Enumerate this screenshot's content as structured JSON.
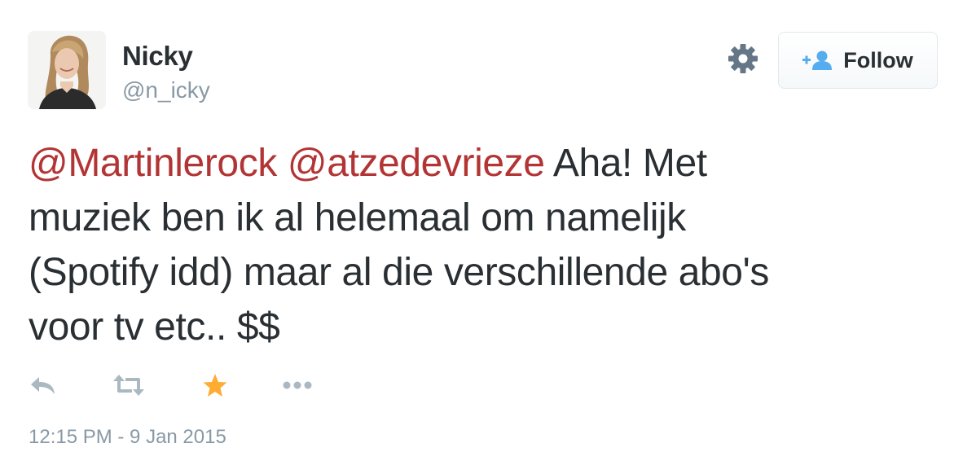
{
  "user": {
    "name": "Nicky",
    "handle": "@n_icky"
  },
  "header": {
    "follow_label": "Follow"
  },
  "tweet": {
    "mentions": [
      "@Martinlerock",
      "@atzedevrieze"
    ],
    "text_lines": [
      " Aha! Met",
      "muziek ben ik al helemaal om namelijk",
      "(Spotify idd) maar al die verschillende abo's",
      "voor tv etc.. $$"
    ],
    "timestamp": "12:15 PM - 9 Jan 2015",
    "favorited": true
  },
  "actions": [
    "reply-icon",
    "retweet-icon",
    "star-icon",
    "more-icon"
  ],
  "colors": {
    "mention": "#b33434",
    "text": "#292f33",
    "muted": "#8899a6",
    "favorite": "#ffac33",
    "follow_icon": "#55acee"
  }
}
